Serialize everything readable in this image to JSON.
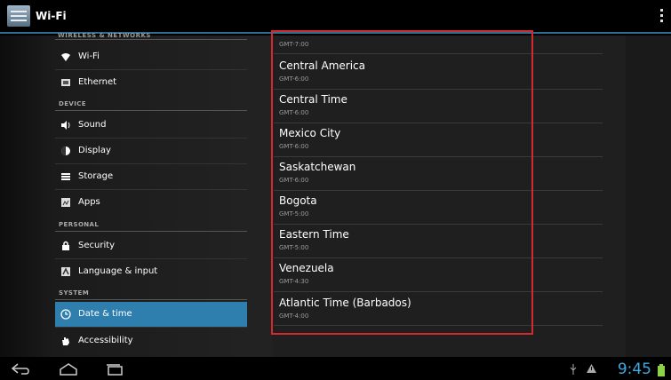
{
  "action_bar": {
    "title": "Wi-Fi",
    "app_icon": "settings-icon",
    "overflow_icon": "overflow-menu-icon"
  },
  "sidebar": {
    "cut_header": "WIRELESS & NETWORKS",
    "items_top": [
      {
        "label": "Wi-Fi",
        "icon": "wifi-icon"
      },
      {
        "label": "Ethernet",
        "icon": "ethernet-icon"
      }
    ],
    "device_header": "DEVICE",
    "device_items": [
      {
        "label": "Sound",
        "icon": "speaker-icon"
      },
      {
        "label": "Display",
        "icon": "brightness-icon"
      },
      {
        "label": "Storage",
        "icon": "storage-icon"
      },
      {
        "label": "Apps",
        "icon": "apps-icon"
      }
    ],
    "personal_header": "PERSONAL",
    "personal_items": [
      {
        "label": "Security",
        "icon": "lock-icon"
      },
      {
        "label": "Language & input",
        "icon": "keyboard-icon"
      }
    ],
    "system_header": "SYSTEM",
    "system_items": [
      {
        "label": "Date & time",
        "icon": "clock-icon",
        "selected": true
      },
      {
        "label": "Accessibility",
        "icon": "hand-icon"
      }
    ]
  },
  "timezones": {
    "top_offset": "GMT-7:00",
    "items": [
      {
        "name": "Central America",
        "offset": "GMT-6:00"
      },
      {
        "name": "Central Time",
        "offset": "GMT-6:00"
      },
      {
        "name": "Mexico City",
        "offset": "GMT-6:00"
      },
      {
        "name": "Saskatchewan",
        "offset": "GMT-6:00"
      },
      {
        "name": "Bogota",
        "offset": "GMT-5:00"
      },
      {
        "name": "Eastern Time",
        "offset": "GMT-5:00"
      },
      {
        "name": "Venezuela",
        "offset": "GMT-4:30"
      },
      {
        "name": "Atlantic Time (Barbados)",
        "offset": "GMT-4:00"
      }
    ]
  },
  "system_bar": {
    "clock": "9:45",
    "clock_color": "#41a8e0",
    "icons": [
      "back-icon",
      "home-icon",
      "recent-apps-icon",
      "usb-icon",
      "warning-icon",
      "battery-icon"
    ]
  },
  "colors": {
    "accent": "#2f7fae",
    "highlight_box": "#d6282f"
  }
}
